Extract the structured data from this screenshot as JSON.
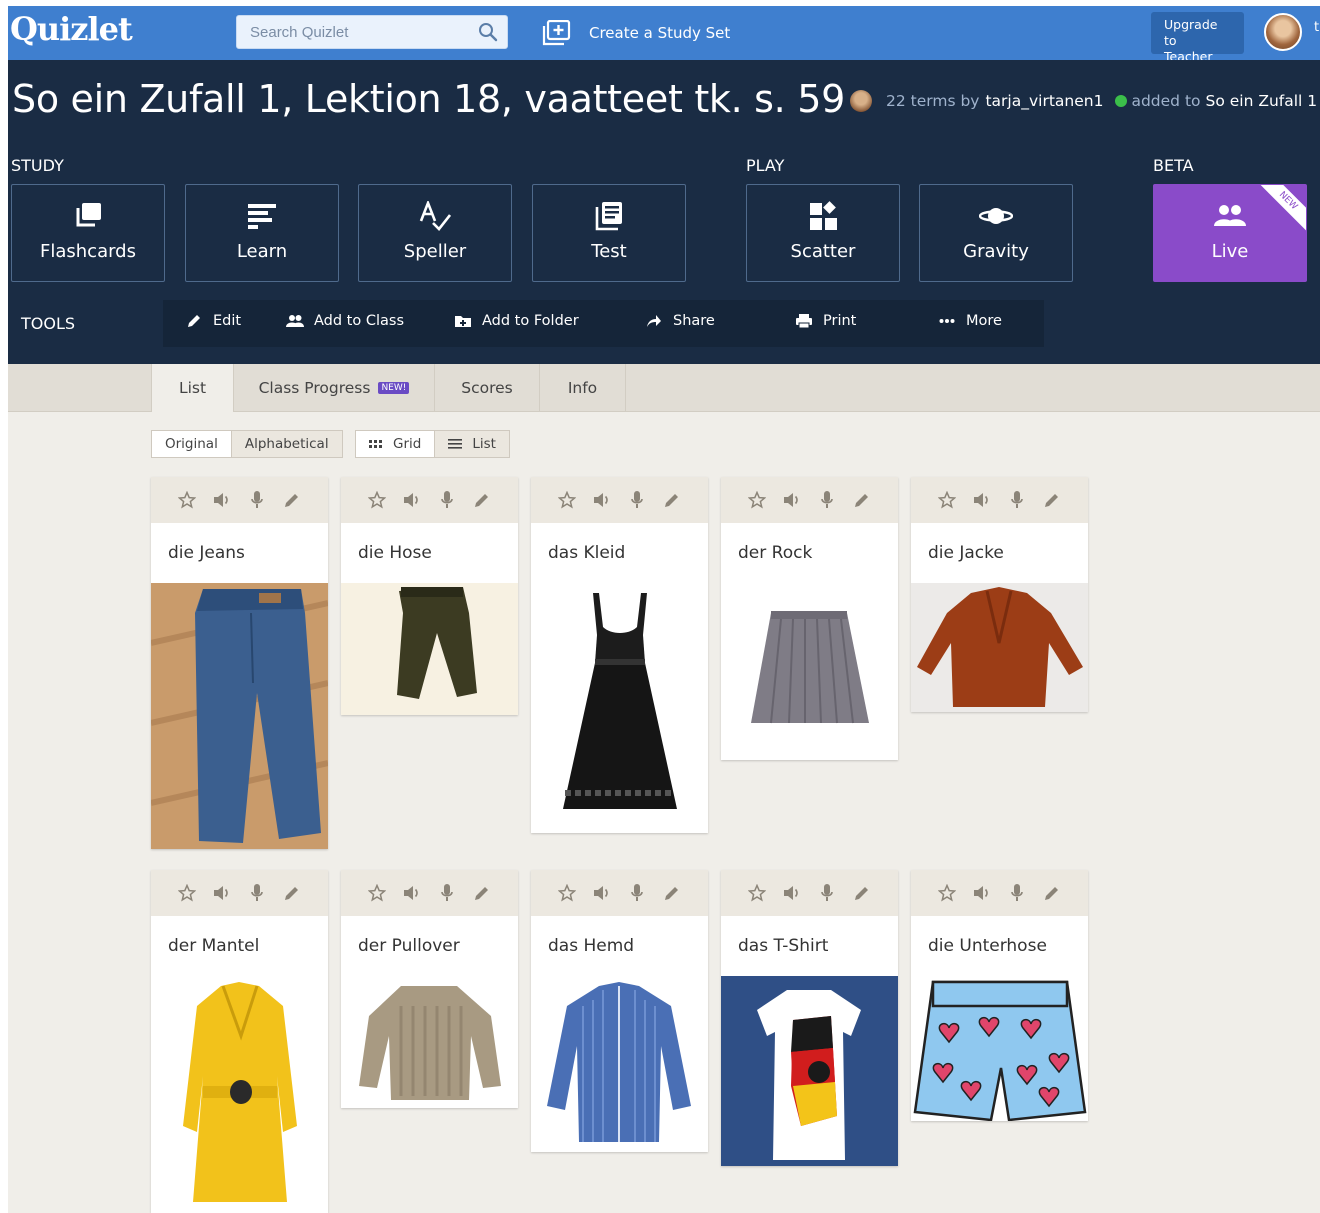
{
  "topbar": {
    "logo": "Quizlet",
    "search_placeholder": "Search Quizlet",
    "create_label": "Create a Study Set",
    "upgrade_line1": "Upgrade to",
    "upgrade_line2": "Teacher",
    "edge_text": "t"
  },
  "set": {
    "title": "So ein Zufall 1, Lektion 18, vaatteet tk. s. 59",
    "terms_by": "22 terms by",
    "user": "tarja_virtanen1",
    "added_to": "added to",
    "folder": "So ein Zufall 1"
  },
  "sections": {
    "study": "STUDY",
    "play": "PLAY",
    "beta": "BETA",
    "tools": "TOOLS"
  },
  "modes": [
    {
      "label": "Flashcards",
      "icon": "flashcards-icon"
    },
    {
      "label": "Learn",
      "icon": "learn-icon"
    },
    {
      "label": "Speller",
      "icon": "speller-icon"
    },
    {
      "label": "Test",
      "icon": "test-icon"
    },
    {
      "label": "Scatter",
      "icon": "scatter-icon"
    },
    {
      "label": "Gravity",
      "icon": "gravity-icon"
    },
    {
      "label": "Live",
      "icon": "live-icon",
      "ribbon": "NEW"
    }
  ],
  "tools": [
    {
      "label": "Edit",
      "icon": "pencil-icon"
    },
    {
      "label": "Add to Class",
      "icon": "people-icon"
    },
    {
      "label": "Add to Folder",
      "icon": "folder-icon"
    },
    {
      "label": "Share",
      "icon": "share-icon"
    },
    {
      "label": "Print",
      "icon": "print-icon"
    },
    {
      "label": "More",
      "icon": "more-icon"
    }
  ],
  "tabs": [
    {
      "label": "List",
      "active": true
    },
    {
      "label": "Class Progress",
      "badge": "NEW!"
    },
    {
      "label": "Scores"
    },
    {
      "label": "Info"
    }
  ],
  "sort": [
    "Original",
    "Alphabetical"
  ],
  "view": [
    "Grid",
    "List"
  ],
  "cards": [
    {
      "word": "die Jeans",
      "image": "jeans"
    },
    {
      "word": "die Hose",
      "image": "trousers"
    },
    {
      "word": "das Kleid",
      "image": "dress"
    },
    {
      "word": "der Rock",
      "image": "skirt"
    },
    {
      "word": "die Jacke",
      "image": "jacket"
    },
    {
      "word": "der Mantel",
      "image": "coat"
    },
    {
      "word": "der Pullover",
      "image": "sweater"
    },
    {
      "word": "das Hemd",
      "image": "shirt"
    },
    {
      "word": "das T-Shirt",
      "image": "t-shirt"
    },
    {
      "word": "die Unterhose",
      "image": "boxer-shorts"
    }
  ],
  "colors": {
    "brand": "#3f7fcf",
    "header": "#1a2c44",
    "live": "#8a4bc9",
    "page": "#f0eee9"
  }
}
